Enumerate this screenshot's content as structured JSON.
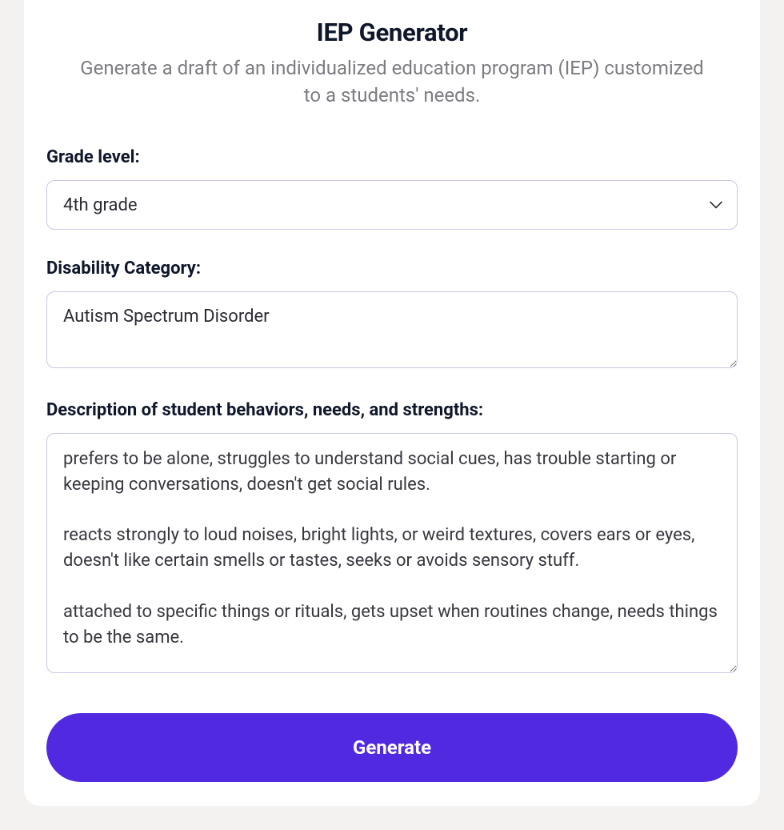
{
  "header": {
    "title": "IEP Generator",
    "subtitle": "Generate a draft of an individualized education program (IEP) customized to a students' needs."
  },
  "fields": {
    "grade_level": {
      "label": "Grade level:",
      "value": "4th grade"
    },
    "disability_category": {
      "label": "Disability Category:",
      "value": "Autism Spectrum Disorder"
    },
    "description": {
      "label": "Description of student behaviors, needs, and strengths:",
      "value": "prefers to be alone, struggles to understand social cues, has trouble starting or keeping conversations, doesn't get social rules.\n\nreacts strongly to loud noises, bright lights, or weird textures, covers ears or eyes, doesn't like certain smells or tastes, seeks or avoids sensory stuff.\n\nattached to specific things or rituals, gets upset when routines change, needs things to be the same."
    }
  },
  "buttons": {
    "generate": "Generate"
  }
}
